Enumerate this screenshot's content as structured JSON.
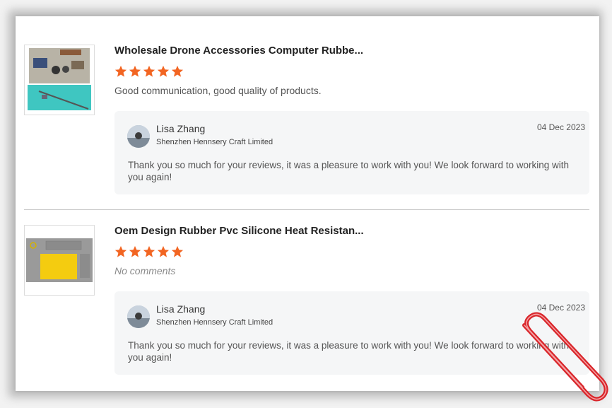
{
  "reviews": [
    {
      "product_title": "Wholesale Drone Accessories Computer Rubbe...",
      "rating": 5,
      "comment": "Good communication, good quality of products.",
      "reply": {
        "name": "Lisa Zhang",
        "company": "Shenzhen Hennsery Craft Limited",
        "date": "04 Dec 2023",
        "text": "Thank you so much for your reviews, it was a pleasure to work with you! We look forward to working with you again!"
      }
    },
    {
      "product_title": "Oem Design Rubber Pvc Silicone Heat Resistan...",
      "rating": 5,
      "comment": "No comments",
      "reply": {
        "name": "Lisa Zhang",
        "company": "Shenzhen Hennsery Craft Limited",
        "date": "04 Dec 2023",
        "text": "Thank you so much for your reviews, it was a pleasure to work with you! We look forward to working with you again!"
      }
    }
  ],
  "colors": {
    "star": "#f26522",
    "reply_bg": "#f5f6f7",
    "clip": "#d9262b"
  },
  "icons": [
    "star-icon",
    "paperclip-icon",
    "avatar"
  ]
}
